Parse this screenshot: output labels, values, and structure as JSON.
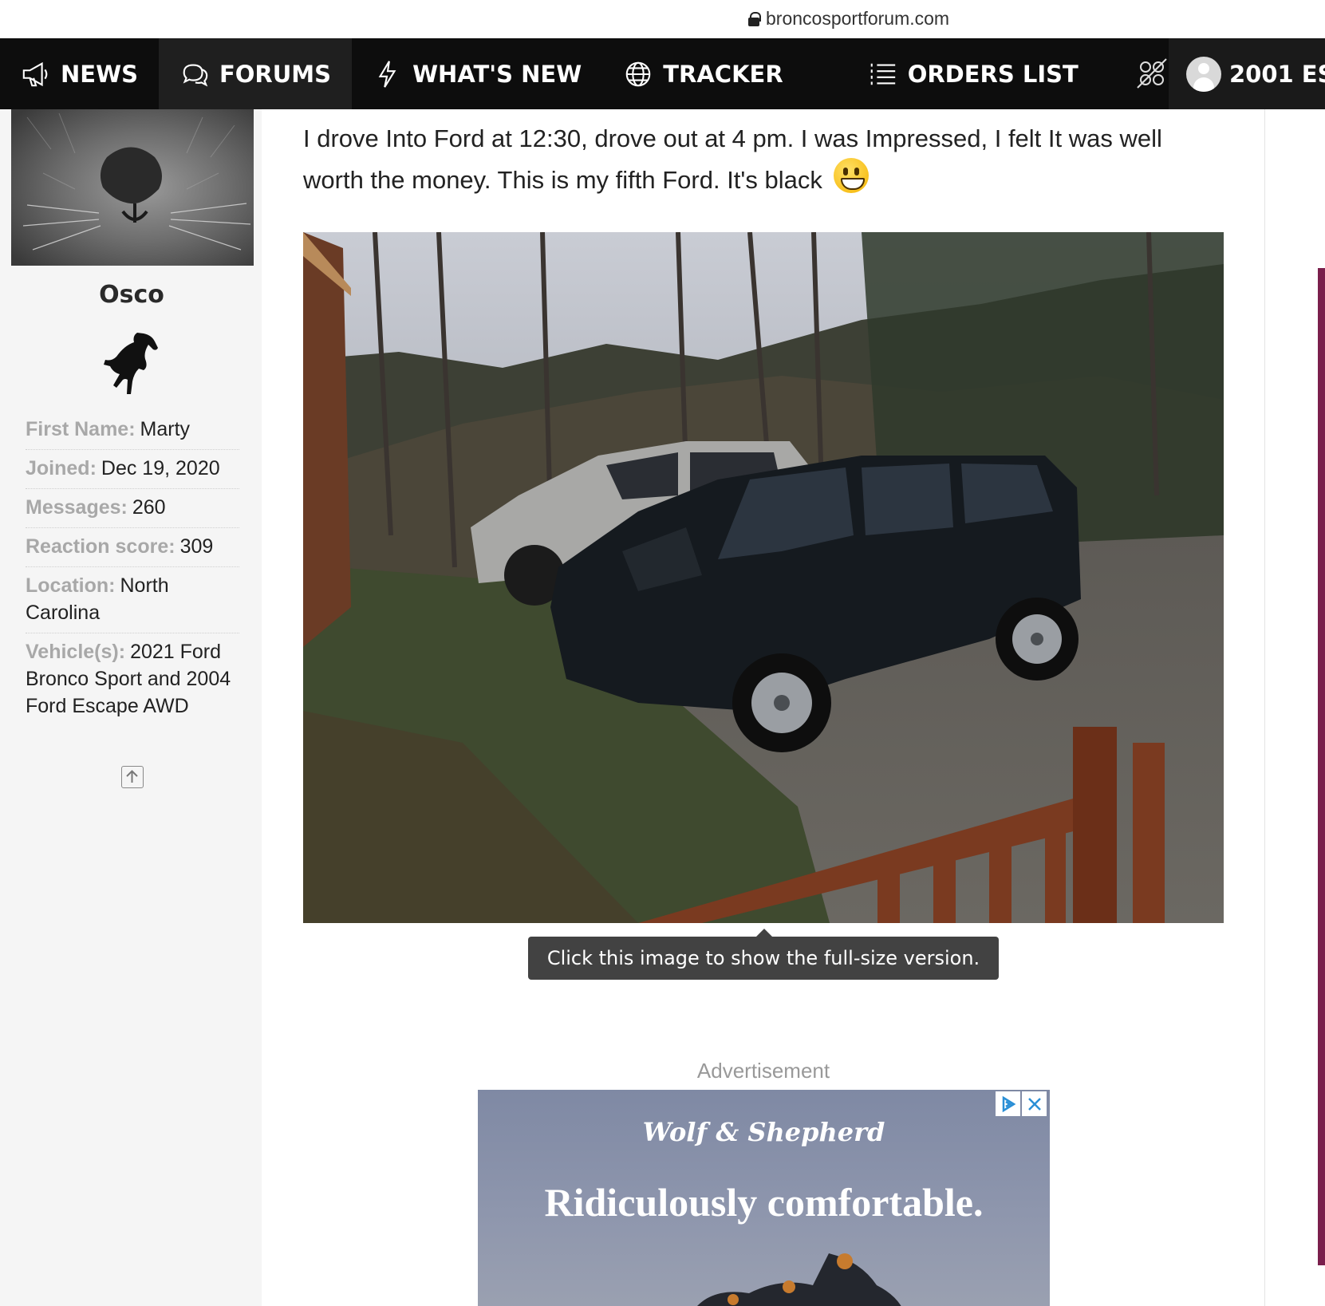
{
  "browser": {
    "url": "broncosportforum.com"
  },
  "nav": {
    "items": [
      {
        "label": "NEWS",
        "icon": "megaphone-icon"
      },
      {
        "label": "FORUMS",
        "icon": "chat-bubbles-icon"
      },
      {
        "label": "WHAT'S NEW",
        "icon": "lightning-icon"
      },
      {
        "label": "TRACKER",
        "icon": "globe-icon"
      },
      {
        "label": "ORDERS LIST",
        "icon": "list-icon"
      }
    ],
    "active": "FORUMS",
    "extra_icon": "no-contrast-icon",
    "user_label": "2001 ES"
  },
  "sidebar": {
    "username": "Osco",
    "badge_icon": "bronco-horse-icon",
    "fields": [
      {
        "key": "First Name:",
        "value": "Marty"
      },
      {
        "key": "Joined:",
        "value": "Dec 19, 2020"
      },
      {
        "key": "Messages:",
        "value": "260"
      },
      {
        "key": "Reaction score:",
        "value": "309"
      },
      {
        "key": "Location:",
        "value": "North Carolina"
      },
      {
        "key": "Vehicle(s):",
        "value": "2021 Ford Bronco Sport and 2004 Ford Escape AWD"
      }
    ]
  },
  "post": {
    "text": "I drove Into Ford at 12:30, drove out at 4 pm. I was Impressed, I felt It was well worth the money. This is my fifth Ford. It's black",
    "emoji": "grinning-face-emoji",
    "image_tooltip": "Click this image to show the full-size version."
  },
  "ad": {
    "label": "Advertisement",
    "brand": "Wolf & Shepherd",
    "tagline": "Ridiculously comfortable."
  },
  "colors": {
    "nav_bg": "#0d0d0d",
    "sidebar_bg": "#f5f5f5",
    "accent": "#7a1f4c",
    "tooltip_bg": "#424242"
  }
}
